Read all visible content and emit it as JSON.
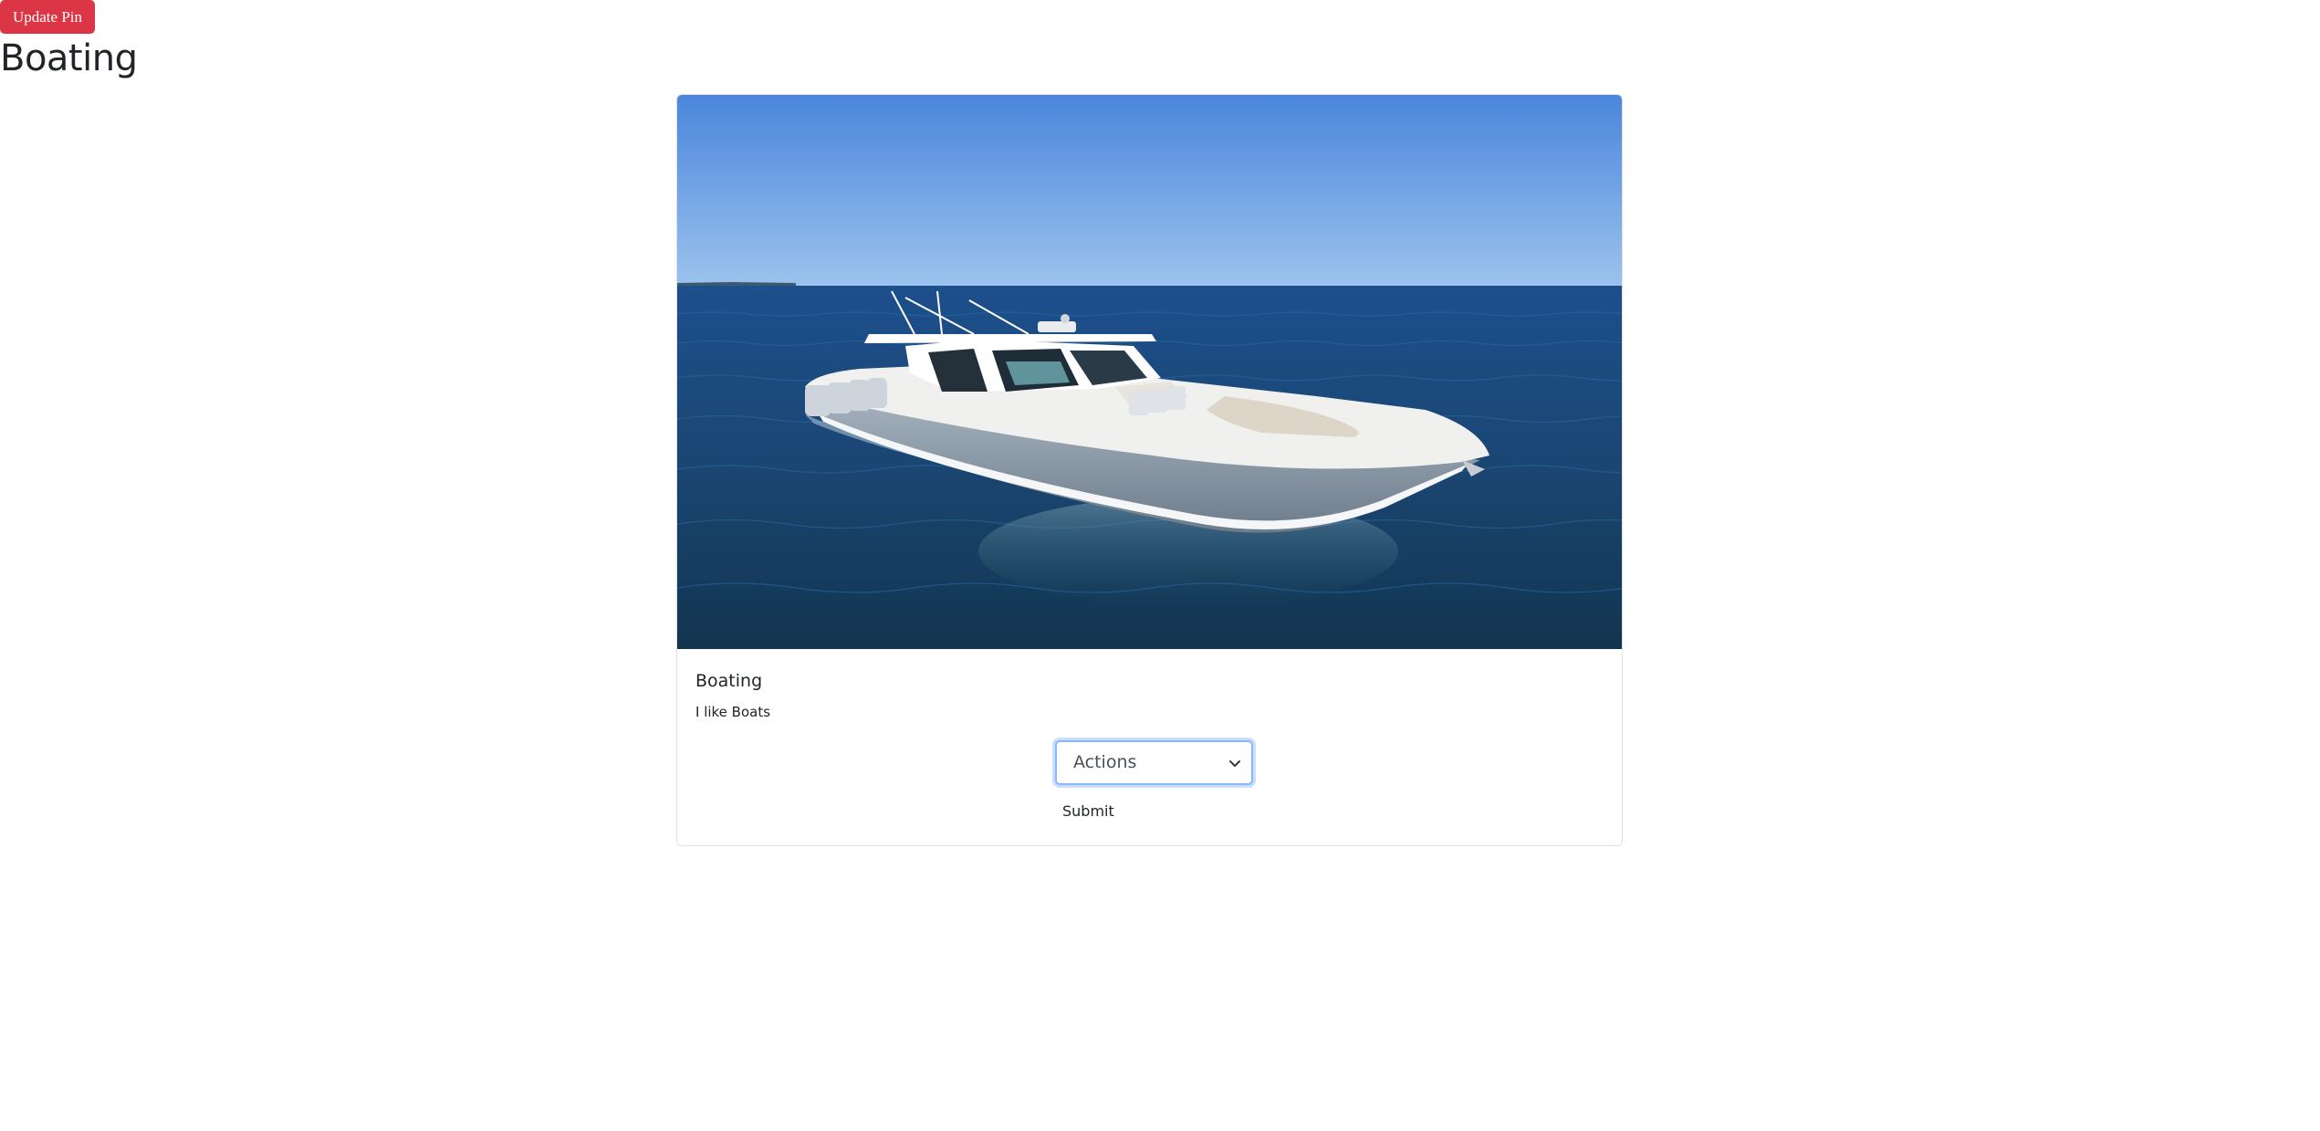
{
  "header": {
    "update_pin_label": "Update Pin",
    "title": "Boating"
  },
  "card": {
    "image_alt_icon": "boat-photo",
    "title": "Boating",
    "text": "I like Boats",
    "actions_select": {
      "selected": "Actions"
    },
    "submit_label": "Submit"
  },
  "colors": {
    "danger": "#dc3545",
    "focus_ring": "#86b7fe",
    "sky_top": "#4a86dc",
    "sea_deep": "#143a5c"
  }
}
